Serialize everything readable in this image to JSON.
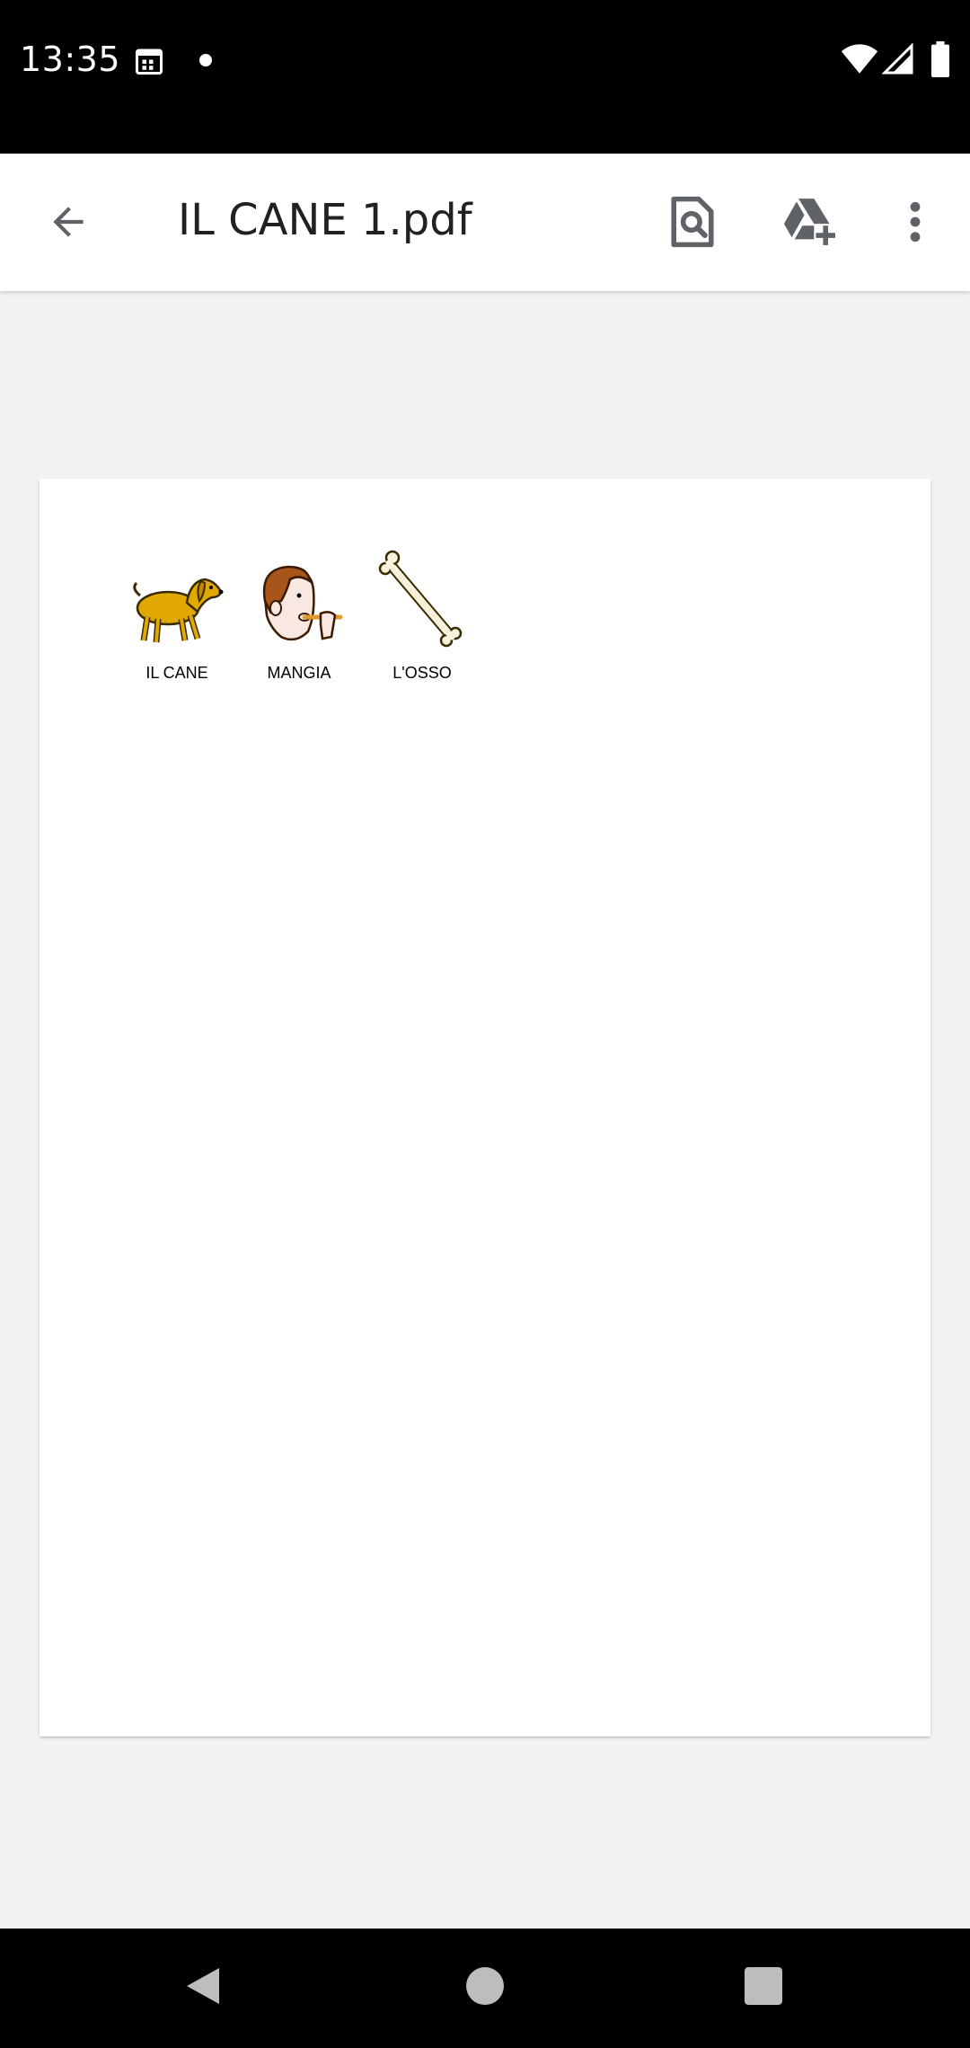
{
  "status_bar": {
    "time": "13:35",
    "icons": [
      "calendar-icon",
      "notification-dot-icon",
      "wifi-icon",
      "signal-icon",
      "battery-icon"
    ]
  },
  "app_bar": {
    "title": "IL CANE 1.pdf",
    "actions": [
      "back-arrow-icon",
      "find-in-page-icon",
      "add-to-drive-icon",
      "more-vert-icon"
    ]
  },
  "document": {
    "symbols": [
      {
        "icon": "dog-icon",
        "label": "IL CANE"
      },
      {
        "icon": "person-eating-icon",
        "label": "MANGIA"
      },
      {
        "icon": "bone-icon",
        "label": "L'OSSO"
      }
    ]
  },
  "nav_bar": {
    "buttons": [
      "nav-back-icon",
      "nav-home-icon",
      "nav-recents-icon"
    ]
  },
  "colors": {
    "status_bar": "#000000",
    "app_bar": "#ffffff",
    "viewer_background": "#f1f2f4",
    "dog": "#e0a800",
    "bone": "#f7f1dc"
  }
}
